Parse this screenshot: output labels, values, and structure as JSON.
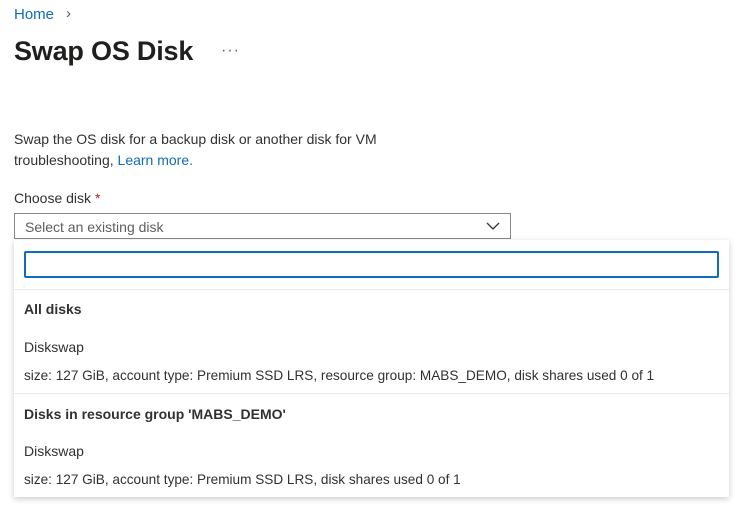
{
  "breadcrumb": {
    "home": "Home",
    "separator": "›"
  },
  "page": {
    "title": "Swap OS Disk",
    "more": "···"
  },
  "description": {
    "text": "Swap the OS disk for a backup disk or another disk for VM troubleshooting, ",
    "link": "Learn more."
  },
  "field": {
    "label": "Choose disk",
    "required": "*",
    "placeholder": "Select an existing disk",
    "search_value": ""
  },
  "groups": [
    {
      "header": "All disks",
      "items": [
        {
          "name": "Diskswap",
          "details": "size: 127 GiB, account type: Premium SSD LRS, resource group: MABS_DEMO, disk shares used 0 of 1"
        }
      ]
    },
    {
      "header": "Disks in resource group 'MABS_DEMO'",
      "items": [
        {
          "name": "Diskswap",
          "details": "size: 127 GiB, account type: Premium SSD LRS, disk shares used 0 of 1"
        }
      ]
    }
  ]
}
